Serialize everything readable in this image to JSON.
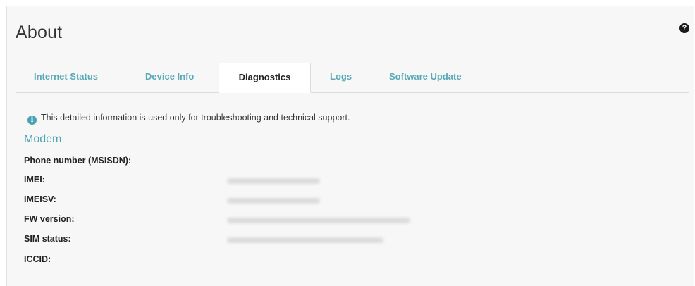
{
  "header": {
    "title": "About",
    "help_icon": "help-circle-icon"
  },
  "tabs": [
    {
      "label": "Internet Status",
      "active": false
    },
    {
      "label": "Device Info",
      "active": false
    },
    {
      "label": "Diagnostics",
      "active": true
    },
    {
      "label": "Logs",
      "active": false
    },
    {
      "label": "Software Update",
      "active": false
    }
  ],
  "diagnostics": {
    "info_icon": "info-icon",
    "info_text": "This detailed information is used only for troubleshooting and technical support.",
    "section_title": "Modem",
    "fields": [
      {
        "label": "Phone number (MSISDN):",
        "value_blurred": false
      },
      {
        "label": "IMEI:",
        "value_blurred": true
      },
      {
        "label": "IMEISV:",
        "value_blurred": true
      },
      {
        "label": "FW version:",
        "value_blurred": true
      },
      {
        "label": "SIM status:",
        "value_blurred": true
      },
      {
        "label": "ICCID:",
        "value_blurred": false
      }
    ]
  },
  "colors": {
    "accent": "#4aa3b4",
    "tab_inactive": "#5aa9b7",
    "panel_bg": "#f7f7f7"
  }
}
